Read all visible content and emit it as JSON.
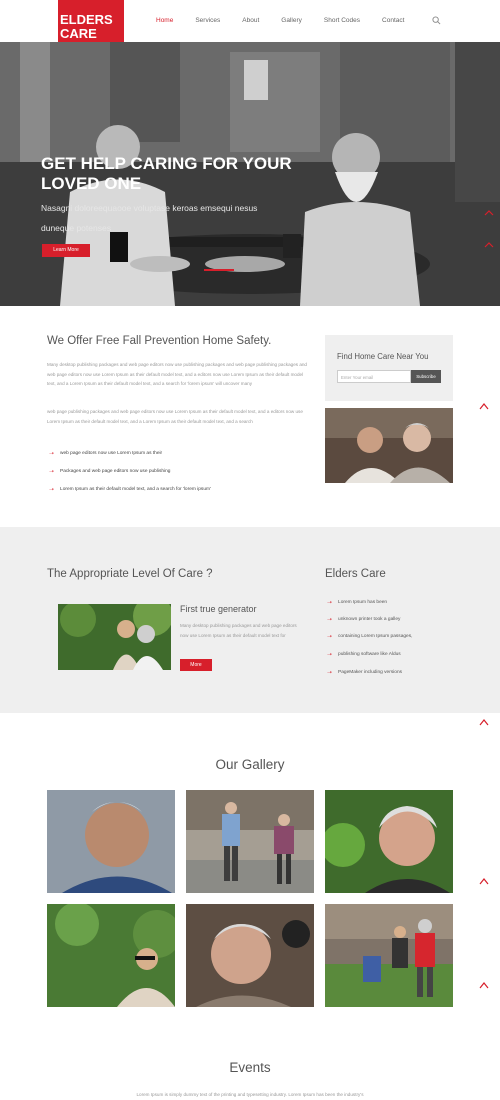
{
  "header": {
    "logo_line1": "ELDERS",
    "logo_line2": "CARE",
    "nav": [
      "Home",
      "Services",
      "About",
      "Gallery",
      "Short Codes",
      "Contact"
    ],
    "active_nav": "Home"
  },
  "hero": {
    "title": "GET HELP CARING FOR YOUR LOVED ONE",
    "text": "Nasagni doloreequaooe voluptase keroas emsequi nesus duneque potenses",
    "button": "Learn More"
  },
  "prevention": {
    "title": "We Offer Free Fall Prevention Home Safety.",
    "para1": "Many desktop publishing packages and web page editors now use publishing packages and web page publishing packages and web page editors now use Lorem Ipsum as their default model text, and a editors now use Lorem Ipsum as their default model text, and a Lorem Ipsum as their default model text, and a search for 'lorem ipsum' will uncover many",
    "para2": "web page publishing packages and web page editors now use Lorem Ipsum as their default model text, and a editors now use Lorem Ipsum as their default model text, and a Lorem Ipsum as their default model text, and a search",
    "bullets": [
      "web page editors now use Lorem Ipsum as their",
      "Packages and web page editors now use publishing",
      "Lorem Ipsum as their default model text, and a search for 'lorem ipsum'"
    ]
  },
  "find_care": {
    "title": "Find Home Care Near You",
    "email_placeholder": "Enter Your email",
    "subscribe": "Subscribe"
  },
  "care_level": {
    "title": "The Appropriate Level Of Care ?",
    "subtitle": "First true generator",
    "text": "Many desktop publishing packages and web page editors now use Lorem Ipsum as their default model text for",
    "button": "More"
  },
  "elders_care": {
    "title": "Elders Care",
    "items": [
      "Lorem Ipsum has been",
      "unknown printer took a galley",
      "containing Lorem Ipsum passages,",
      "publishing software like Aldus",
      "PageMaker including versions"
    ]
  },
  "gallery": {
    "title": "Our Gallery"
  },
  "events": {
    "title": "Events",
    "text": "Lorem Ipsum is simply dummy text of the printing and typesetting industry. Lorem Ipsum has been the industry's"
  },
  "colors": {
    "accent": "#d71f2b",
    "gray_bg": "#efefef"
  }
}
